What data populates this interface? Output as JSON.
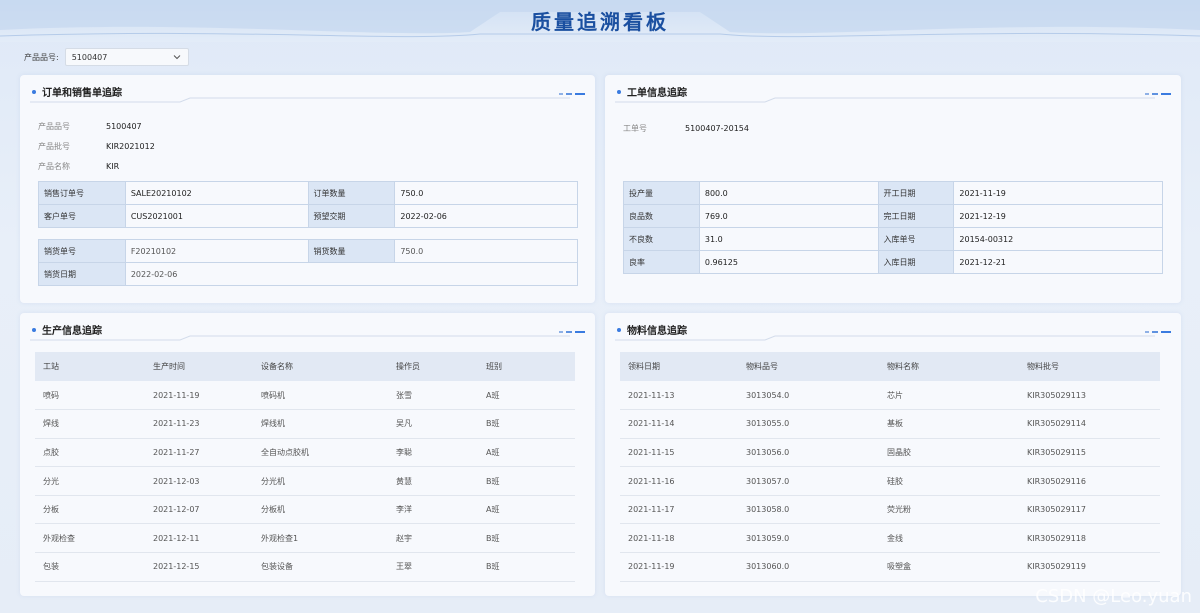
{
  "title": "质量追溯看板",
  "selector": {
    "label": "产品品号:",
    "value": "5100407"
  },
  "order_panel": {
    "title": "订单和销售单追踪",
    "info": [
      {
        "label": "产品品号",
        "value": "5100407"
      },
      {
        "label": "产品批号",
        "value": "KIR2021012"
      },
      {
        "label": "产品名称",
        "value": "KIR"
      }
    ],
    "order_table": [
      [
        "销售订单号",
        "SALE20210102",
        "订单数量",
        "750.0"
      ],
      [
        "客户单号",
        "CUS2021001",
        "预望交期",
        "2022-02-06"
      ]
    ],
    "ship_table": {
      "row1": [
        "销货单号",
        "F20210102",
        "销货数量",
        "750.0"
      ],
      "row2": [
        "销货日期",
        "2022-02-06"
      ]
    }
  },
  "work_panel": {
    "title": "工单信息追踪",
    "info": {
      "label": "工单号",
      "value": "5100407-20154"
    },
    "table": [
      [
        "投产量",
        "800.0",
        "开工日期",
        "2021-11-19"
      ],
      [
        "良品数",
        "769.0",
        "完工日期",
        "2021-12-19"
      ],
      [
        "不良数",
        "31.0",
        "入库单号",
        "20154-00312"
      ],
      [
        "良率",
        "0.96125",
        "入库日期",
        "2021-12-21"
      ]
    ]
  },
  "production_panel": {
    "title": "生产信息追踪",
    "headers": [
      "工站",
      "生产时间",
      "设备名称",
      "操作员",
      "班别"
    ],
    "rows": [
      [
        "喷码",
        "2021-11-19",
        "喷码机",
        "张雪",
        "A班"
      ],
      [
        "焊线",
        "2021-11-23",
        "焊线机",
        "吴凡",
        "B班"
      ],
      [
        "点胶",
        "2021-11-27",
        "全自动点胶机",
        "李聪",
        "A班"
      ],
      [
        "分光",
        "2021-12-03",
        "分光机",
        "黄慧",
        "B班"
      ],
      [
        "分板",
        "2021-12-07",
        "分板机",
        "李洋",
        "A班"
      ],
      [
        "外观检查",
        "2021-12-11",
        "外观检查1",
        "赵宇",
        "B班"
      ],
      [
        "包装",
        "2021-12-15",
        "包装设备",
        "王翠",
        "B班"
      ]
    ]
  },
  "material_panel": {
    "title": "物料信息追踪",
    "headers": [
      "领料日期",
      "物料品号",
      "物料名称",
      "物料批号"
    ],
    "rows": [
      [
        "2021-11-13",
        "3013054.0",
        "芯片",
        "KIR305029113"
      ],
      [
        "2021-11-14",
        "3013055.0",
        "基板",
        "KIR305029114"
      ],
      [
        "2021-11-15",
        "3013056.0",
        "固晶胶",
        "KIR305029115"
      ],
      [
        "2021-11-16",
        "3013057.0",
        "硅胶",
        "KIR305029116"
      ],
      [
        "2021-11-17",
        "3013058.0",
        "荧光粉",
        "KIR305029117"
      ],
      [
        "2021-11-18",
        "3013059.0",
        "金线",
        "KIR305029118"
      ],
      [
        "2021-11-19",
        "3013060.0",
        "吸塑盒",
        "KIR305029119"
      ]
    ]
  },
  "watermark": "CSDN @Leo.yuan",
  "colors": {
    "accent": "#3a7be0",
    "title": "#1a4fa0",
    "cell_header": "#dbe6f5",
    "border": "#c7d5e8"
  }
}
